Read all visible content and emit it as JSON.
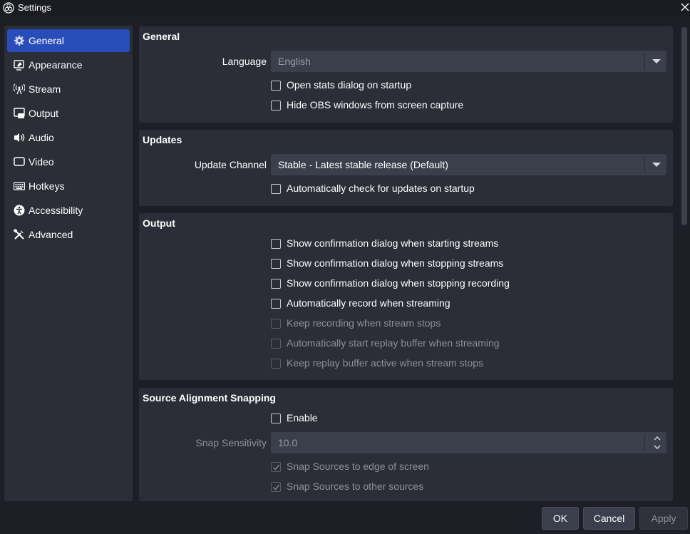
{
  "window": {
    "title": "Settings"
  },
  "sidebar": {
    "items": [
      {
        "label": "General",
        "icon": "gear-icon",
        "active": true
      },
      {
        "label": "Appearance",
        "icon": "appearance-icon"
      },
      {
        "label": "Stream",
        "icon": "broadcast-icon"
      },
      {
        "label": "Output",
        "icon": "output-icon"
      },
      {
        "label": "Audio",
        "icon": "speaker-icon"
      },
      {
        "label": "Video",
        "icon": "monitor-icon"
      },
      {
        "label": "Hotkeys",
        "icon": "keyboard-icon"
      },
      {
        "label": "Accessibility",
        "icon": "accessibility-icon"
      },
      {
        "label": "Advanced",
        "icon": "tools-icon"
      }
    ]
  },
  "general": {
    "title": "General",
    "language_label": "Language",
    "language_value": "English",
    "open_stats_label": "Open stats dialog on startup",
    "hide_obs_label": "Hide OBS windows from screen capture"
  },
  "updates": {
    "title": "Updates",
    "channel_label": "Update Channel",
    "channel_value": "Stable - Latest stable release (Default)",
    "auto_check_label": "Automatically check for updates on startup"
  },
  "output": {
    "title": "Output",
    "options": [
      {
        "label": "Show confirmation dialog when starting streams",
        "checked": false,
        "enabled": true
      },
      {
        "label": "Show confirmation dialog when stopping streams",
        "checked": false,
        "enabled": true
      },
      {
        "label": "Show confirmation dialog when stopping recording",
        "checked": false,
        "enabled": true
      },
      {
        "label": "Automatically record when streaming",
        "checked": false,
        "enabled": true
      },
      {
        "label": "Keep recording when stream stops",
        "checked": false,
        "enabled": false
      },
      {
        "label": "Automatically start replay buffer when streaming",
        "checked": false,
        "enabled": false
      },
      {
        "label": "Keep replay buffer active when stream stops",
        "checked": false,
        "enabled": false
      }
    ]
  },
  "snapping": {
    "title": "Source Alignment Snapping",
    "enable_label": "Enable",
    "sensitivity_label": "Snap Sensitivity",
    "sensitivity_value": "10.0",
    "edge_label": "Snap Sources to edge of screen",
    "sources_label": "Snap Sources to other sources"
  },
  "buttons": {
    "ok": "OK",
    "cancel": "Cancel",
    "apply": "Apply"
  },
  "colors": {
    "accent": "#284cb8",
    "panel": "#2b2d37",
    "background": "#1e1f26"
  }
}
